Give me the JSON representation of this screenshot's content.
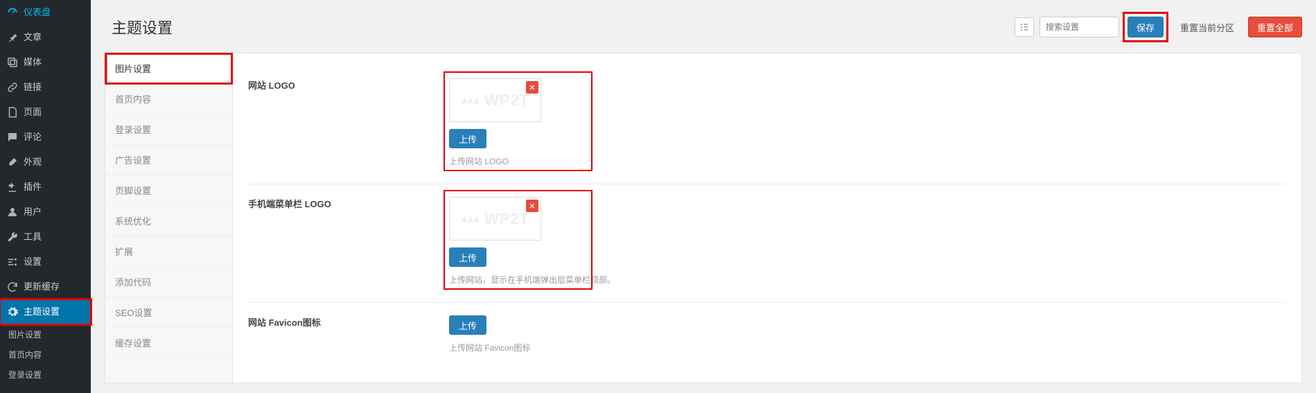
{
  "sidebar": {
    "items": [
      {
        "icon": "dashboard",
        "label": "仪表盘"
      },
      {
        "icon": "pin",
        "label": "文章"
      },
      {
        "icon": "media",
        "label": "媒体"
      },
      {
        "icon": "link",
        "label": "链接"
      },
      {
        "icon": "page",
        "label": "页面"
      },
      {
        "icon": "comment",
        "label": "评论"
      },
      {
        "icon": "brush",
        "label": "外观"
      },
      {
        "icon": "plugin",
        "label": "插件"
      },
      {
        "icon": "user",
        "label": "用户"
      },
      {
        "icon": "tool",
        "label": "工具"
      },
      {
        "icon": "settings",
        "label": "设置"
      },
      {
        "icon": "refresh",
        "label": "更新缓存"
      },
      {
        "icon": "gear",
        "label": "主题设置"
      }
    ],
    "sub_items": [
      "图片设置",
      "首页内容",
      "登录设置"
    ]
  },
  "header": {
    "title": "主题设置",
    "search_placeholder": "搜索设置",
    "save_label": "保存",
    "reset_section_label": "重置当前分区",
    "reset_all_label": "重置全部"
  },
  "panel": {
    "tabs": [
      "图片设置",
      "首页内容",
      "登录设置",
      "广告设置",
      "页脚设置",
      "系统优化",
      "扩展",
      "添加代码",
      "SEO设置",
      "缓存设置"
    ],
    "active_tab": 0,
    "fields": [
      {
        "label": "网站 LOGO",
        "upload_label": "上传",
        "desc": "上传网站 LOGO",
        "has_media": true
      },
      {
        "label": "手机端菜单栏 LOGO",
        "upload_label": "上传",
        "desc": "上传网站，显示在手机端弹出层菜单栏顶部。",
        "has_media": true
      },
      {
        "label": "网站 Favicon图标",
        "upload_label": "上传",
        "desc": "上传网站 Favicon图标",
        "has_media": false
      }
    ],
    "watermark_text": "WP2T"
  },
  "colors": {
    "primary": "#2980b9",
    "danger": "#e74c3c",
    "highlight": "#e20000",
    "sidebar_active": "#0073aa"
  }
}
